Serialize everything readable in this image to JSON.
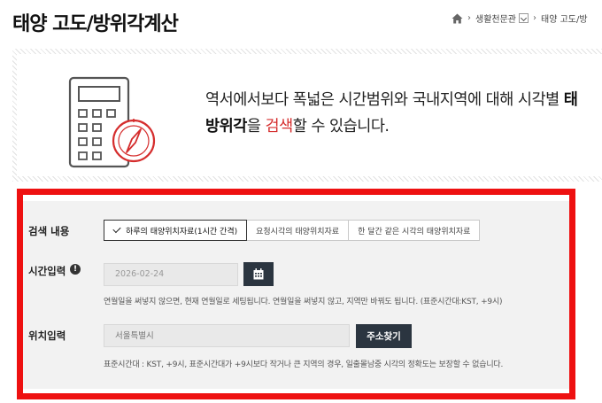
{
  "page_title": "태양 고도/방위각계산",
  "breadcrumb": {
    "home_icon": "home-icon",
    "level1": "생활천문관",
    "level2": "태양 고도/방"
  },
  "intro": {
    "line1_prefix": "역서에서보다 폭넓은 시간범위와 국내지역에 대해 시각별 ",
    "line1_bold": "태",
    "line2_bold": "방위각",
    "line2_mid": "을 ",
    "line2_red": "검색",
    "line2_suffix": "할 수 있습니다.",
    "icon": "calculator-compass-icon"
  },
  "form": {
    "search_label": "검색 내용",
    "tabs": [
      {
        "label": "하루의 태양위치자료(1시간 간격)",
        "active": true
      },
      {
        "label": "요청시각의 태양위치자료",
        "active": false
      },
      {
        "label": "한 달간 같은 시각의 태양위치자료",
        "active": false
      }
    ],
    "time_label": "시간입력",
    "info_glyph": "!",
    "date_value": "2026-02-24",
    "time_hint": "연월일을 써넣지 않으면, 현재 연월일로 세팅됩니다. 연월일을 써넣지 않고, 지역만 바꿔도 됩니다. (표준시간대:KST, +9시)",
    "location_label": "위치입력",
    "location_placeholder": "서울특별시",
    "address_button": "주소찾기",
    "location_hint": "표준시간대 : KST, +9시, 표준시간대가 +9시보다 작거나 큰 지역의 경우, 일출몰남중 시각의 정확도는 보장할 수 없습니다."
  },
  "colors": {
    "highlight_frame": "#ee1111",
    "button_dark": "#2b3540",
    "accent_red": "#d52d2d"
  }
}
